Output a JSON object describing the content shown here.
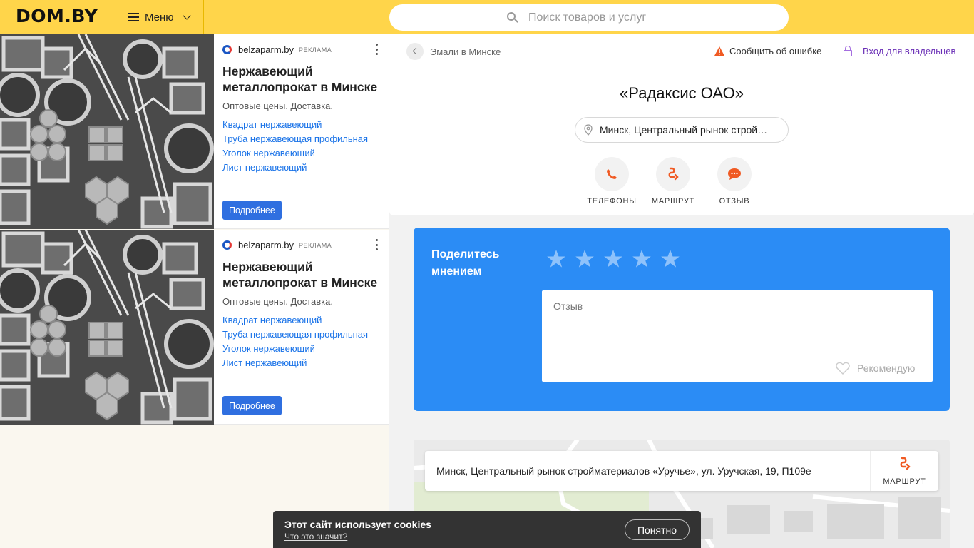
{
  "header": {
    "logo": "DOM.BY",
    "menu_label": "Меню",
    "search_placeholder": "Поиск товаров и услуг"
  },
  "ads": [
    {
      "domain": "belzaparm.by",
      "tag": "РЕКЛАМА",
      "title": "Нержавеющий металлопрокат в Минске",
      "desc": "Оптовые цены. Доставка.",
      "links": [
        "Квадрат нержавеющий",
        "Труба нержавеющая профильная",
        "Уголок нержавеющий",
        "Лист нержавеющий"
      ],
      "button": "Подробнее"
    },
    {
      "domain": "belzaparm.by",
      "tag": "РЕКЛАМА",
      "title": "Нержавеющий металлопрокат в Минске",
      "desc": "Оптовые цены. Доставка.",
      "links": [
        "Квадрат нержавеющий",
        "Труба нержавеющая профильная",
        "Уголок нержавеющий",
        "Лист нержавеющий"
      ],
      "button": "Подробнее"
    }
  ],
  "card": {
    "breadcrumb": "Эмали в Минске",
    "report": "Сообщить об ошибке",
    "login": "Вход для владельцев",
    "company": "«Радаксис ОАО»",
    "address_short": "Минск, Центральный рынок строй…",
    "actions": [
      "ТЕЛЕФОНЫ",
      "МАРШРУТ",
      "ОТЗЫВ"
    ]
  },
  "review": {
    "heading": "Поделитесь мнением",
    "placeholder": "Отзыв",
    "recommend": "Рекомендую",
    "stars": 5
  },
  "map": {
    "address": "Минск, Центральный рынок стройматериалов «Уручье», ул. Уручская, 19, П109е",
    "route": "МАРШРУТ"
  },
  "cookie": {
    "message": "Этот сайт использует cookies",
    "link": "Что это значит?",
    "button": "Понятно"
  },
  "colors": {
    "header": "#ffd54a",
    "review_bg": "#2b8cf5",
    "accent_orange": "#f05a23",
    "link_blue": "#1a73e8",
    "login_purple": "#6a2fb6"
  }
}
